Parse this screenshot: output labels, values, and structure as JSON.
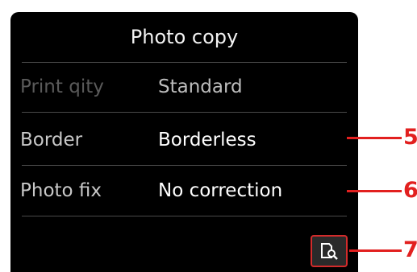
{
  "screen": {
    "title": "Photo copy",
    "settings": [
      {
        "label": "Print qity",
        "value": "Standard",
        "dimmed": true
      },
      {
        "label": "Border",
        "value": "Borderless",
        "dimmed": false
      },
      {
        "label": "Photo fix",
        "value": "No correction",
        "dimmed": false
      }
    ],
    "preview_icon": "preview-magnifier-icon"
  },
  "callouts": [
    "5",
    "6",
    "7"
  ],
  "colors": {
    "screen_bg": "#000000",
    "callout": "#e2201f",
    "separator": "#4a4a4a"
  }
}
